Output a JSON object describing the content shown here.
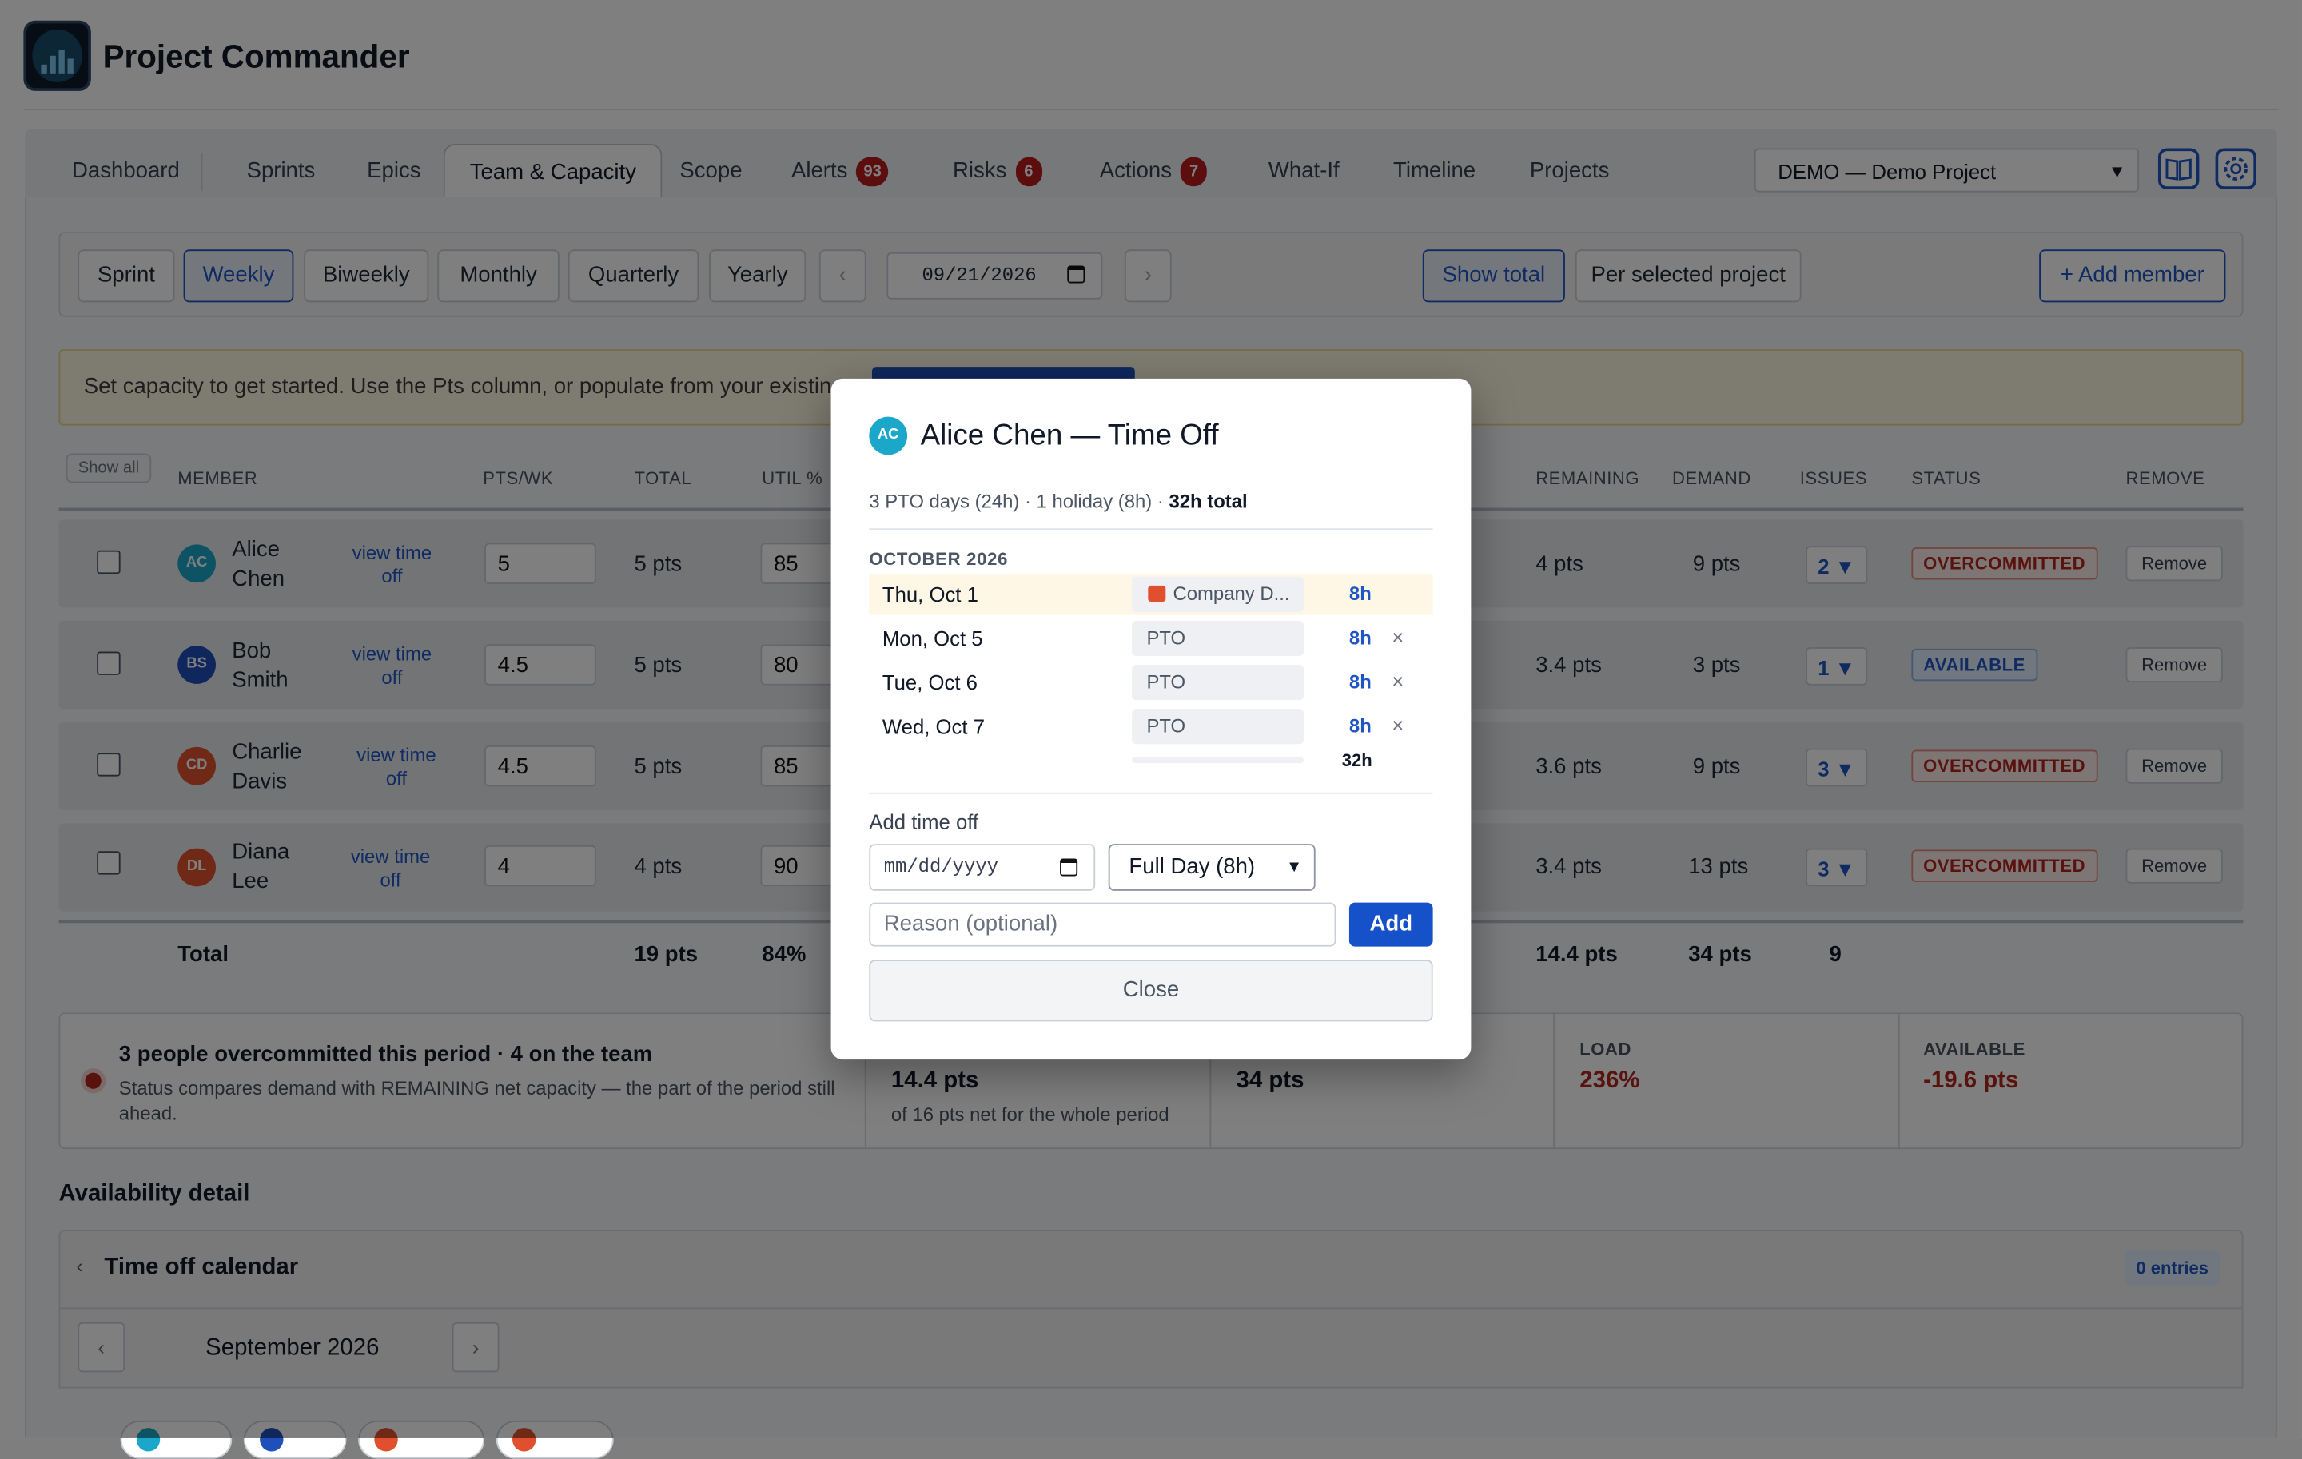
{
  "app": {
    "title": "Project Commander"
  },
  "tabs": [
    {
      "label": "Dashboard"
    },
    {
      "label": "Sprints"
    },
    {
      "label": "Epics"
    },
    {
      "label": "Team & Capacity"
    },
    {
      "label": "Scope"
    },
    {
      "label": "Alerts",
      "count": "93"
    },
    {
      "label": "Risks",
      "count": "6"
    },
    {
      "label": "Actions",
      "count": "7"
    },
    {
      "label": "What-If"
    },
    {
      "label": "Timeline"
    },
    {
      "label": "Projects"
    }
  ],
  "project_select": {
    "value": "DEMO — Demo Project"
  },
  "header_icons": [
    "book-icon",
    "gear-icon"
  ],
  "periods": {
    "options": [
      "Sprint",
      "Weekly",
      "Biweekly",
      "Monthly",
      "Quarterly",
      "Yearly"
    ],
    "selected": "Weekly",
    "prev": "‹",
    "next": "›",
    "date": "09/21/2026"
  },
  "view_toggle": {
    "show_total": "Show total",
    "per_project": "Per selected project",
    "selected": "Show total"
  },
  "add_member": "+ Add member",
  "banner": {
    "text": "Set capacity to get started. Use the Pts column, or populate from your existing rat"
  },
  "table": {
    "show_all": "Show all",
    "headers": {
      "member": "MEMBER",
      "pts": "PTS/WK",
      "total": "TOTAL",
      "util": "UTIL %",
      "remaining": "REMAINING",
      "demand": "DEMAND",
      "issues": "ISSUES",
      "status": "STATUS",
      "remove": "REMOVE"
    },
    "rows": [
      {
        "initials": "AC",
        "first": "Alice",
        "last": "Chen",
        "link1": "view time",
        "link2": "off",
        "pts": "5",
        "total": "5 pts",
        "util": "85",
        "remaining": "4 pts",
        "demand": "9 pts",
        "issues": "2 ▼",
        "status": "OVERCOMMITTED",
        "remove": "Remove",
        "color": "#1aa7c9"
      },
      {
        "initials": "BS",
        "first": "Bob",
        "last": "Smith",
        "link1": "view time",
        "link2": "off",
        "pts": "4.5",
        "total": "5 pts",
        "util": "80",
        "remaining": "3.4 pts",
        "demand": "3 pts",
        "issues": "1 ▼",
        "status": "AVAILABLE",
        "remove": "Remove",
        "color": "#1f4fb8"
      },
      {
        "initials": "CD",
        "first": "Charlie",
        "last": "Davis",
        "link1": "view time",
        "link2": "off",
        "pts": "4.5",
        "total": "5 pts",
        "util": "85",
        "remaining": "3.6 pts",
        "demand": "9 pts",
        "issues": "3 ▼",
        "status": "OVERCOMMITTED",
        "remove": "Remove",
        "color": "#e0502e"
      },
      {
        "initials": "DL",
        "first": "Diana",
        "last": "Lee",
        "link1": "view time",
        "link2": "off",
        "pts": "4",
        "total": "4 pts",
        "util": "90",
        "remaining": "3.4 pts",
        "demand": "13 pts",
        "issues": "3 ▼",
        "status": "OVERCOMMITTED",
        "remove": "Remove",
        "color": "#e0502e"
      }
    ],
    "totals": {
      "label": "Total",
      "total": "19 pts",
      "util": "84%",
      "remaining": "14.4 pts",
      "demand": "34 pts",
      "issues": "9"
    }
  },
  "summary": {
    "headline": "3 people overcommitted this period · 4 on the team",
    "note": "Status compares demand with REMAINING net capacity — the part of the period still ahead.",
    "remaining_value": "14.4 pts",
    "remaining_note": "of 16 pts net for the whole period",
    "demand_value": "34 pts",
    "load_label": "LOAD",
    "load_value": "236%",
    "available_label": "AVAILABLE",
    "available_value": "-19.6 pts",
    "status_color": "#b3261e"
  },
  "availability": {
    "title": "Availability detail",
    "calendar_title": "Time off calendar",
    "calendar_toggle": "‹",
    "entries": "0 entries",
    "month": "September 2026",
    "prev": "‹",
    "next": "›"
  },
  "modal": {
    "initials": "AC",
    "title": "Alice Chen — Time Off",
    "summary_plain": "3 PTO days (24h) · 1 holiday (8h) · ",
    "summary_bold": "32h total",
    "month": "OCTOBER 2026",
    "entries": [
      {
        "date": "Thu, Oct 1",
        "reason": "Company D...",
        "hours": "8h",
        "holiday": true
      },
      {
        "date": "Mon, Oct 5",
        "reason": "PTO",
        "hours": "8h",
        "remove": "×"
      },
      {
        "date": "Tue, Oct 6",
        "reason": "PTO",
        "hours": "8h",
        "remove": "×"
      },
      {
        "date": "Wed, Oct 7",
        "reason": "PTO",
        "hours": "8h",
        "remove": "×"
      }
    ],
    "sum": "32h",
    "add_label": "Add time off",
    "date_placeholder": "mm/dd/yyyy",
    "type_value": "Full Day (8h)",
    "reason_placeholder": "Reason (optional)",
    "add_button": "Add",
    "close_button": "Close",
    "accent": "#1552c9"
  }
}
